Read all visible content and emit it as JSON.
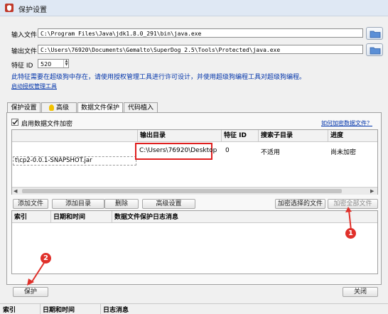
{
  "window": {
    "title": "保护设置"
  },
  "input_file": {
    "label": "输入文件",
    "value": "C:\\Program Files\\Java\\jdk1.8.0_291\\bin\\java.exe"
  },
  "output_file": {
    "label": "输出文件",
    "value": "C:\\Users\\76920\\Documents\\Gemalto\\SuperDog 2.5\\Tools\\Protected\\java.exe"
  },
  "feature_id": {
    "label": "特征 ID",
    "value": "520"
  },
  "tip": "此特征需要在超级狗中存在，请使用授权管理工具进行许可设计，并使用超级狗编程工具对超级狗编程。",
  "auth_link": "启动授权管理工具",
  "tabs": [
    {
      "label": "保护设置"
    },
    {
      "label": "高级"
    },
    {
      "label": "数据文件保护"
    },
    {
      "label": "代码植入"
    }
  ],
  "data_protect": {
    "enable_label": "启用数据文件加密",
    "enabled": true,
    "help_link": "如何加密数据文件？",
    "columns": [
      "",
      "输出目录",
      "特征 ID",
      "搜索子目录",
      "进度"
    ],
    "row": {
      "input_path": "t\\cp2-0.0.1-SNAPSHOT.jar",
      "output_dir": "C:\\Users\\76920\\Desktop",
      "feature_id": "0",
      "subdir": "不适用",
      "progress": "尚未加密"
    },
    "buttons": {
      "add_file": "添加文件",
      "add_dir": "添加目录",
      "delete": "删除",
      "advanced": "高级设置",
      "encrypt_selected": "加密选择的文件",
      "encrypt_all": "加密全部文件"
    },
    "log_columns": [
      "索引",
      "日期和时间",
      "数据文件保护日志消息"
    ]
  },
  "callouts": {
    "one": "1",
    "two": "2"
  },
  "bottom_buttons": {
    "protect": "保护",
    "close": "关闭"
  },
  "status_columns": [
    "索引",
    "日期和时间",
    "日志消息"
  ],
  "colors": {
    "accent_red": "#e0302a",
    "link_blue": "#0033aa",
    "highlight_box": "#e02020"
  }
}
